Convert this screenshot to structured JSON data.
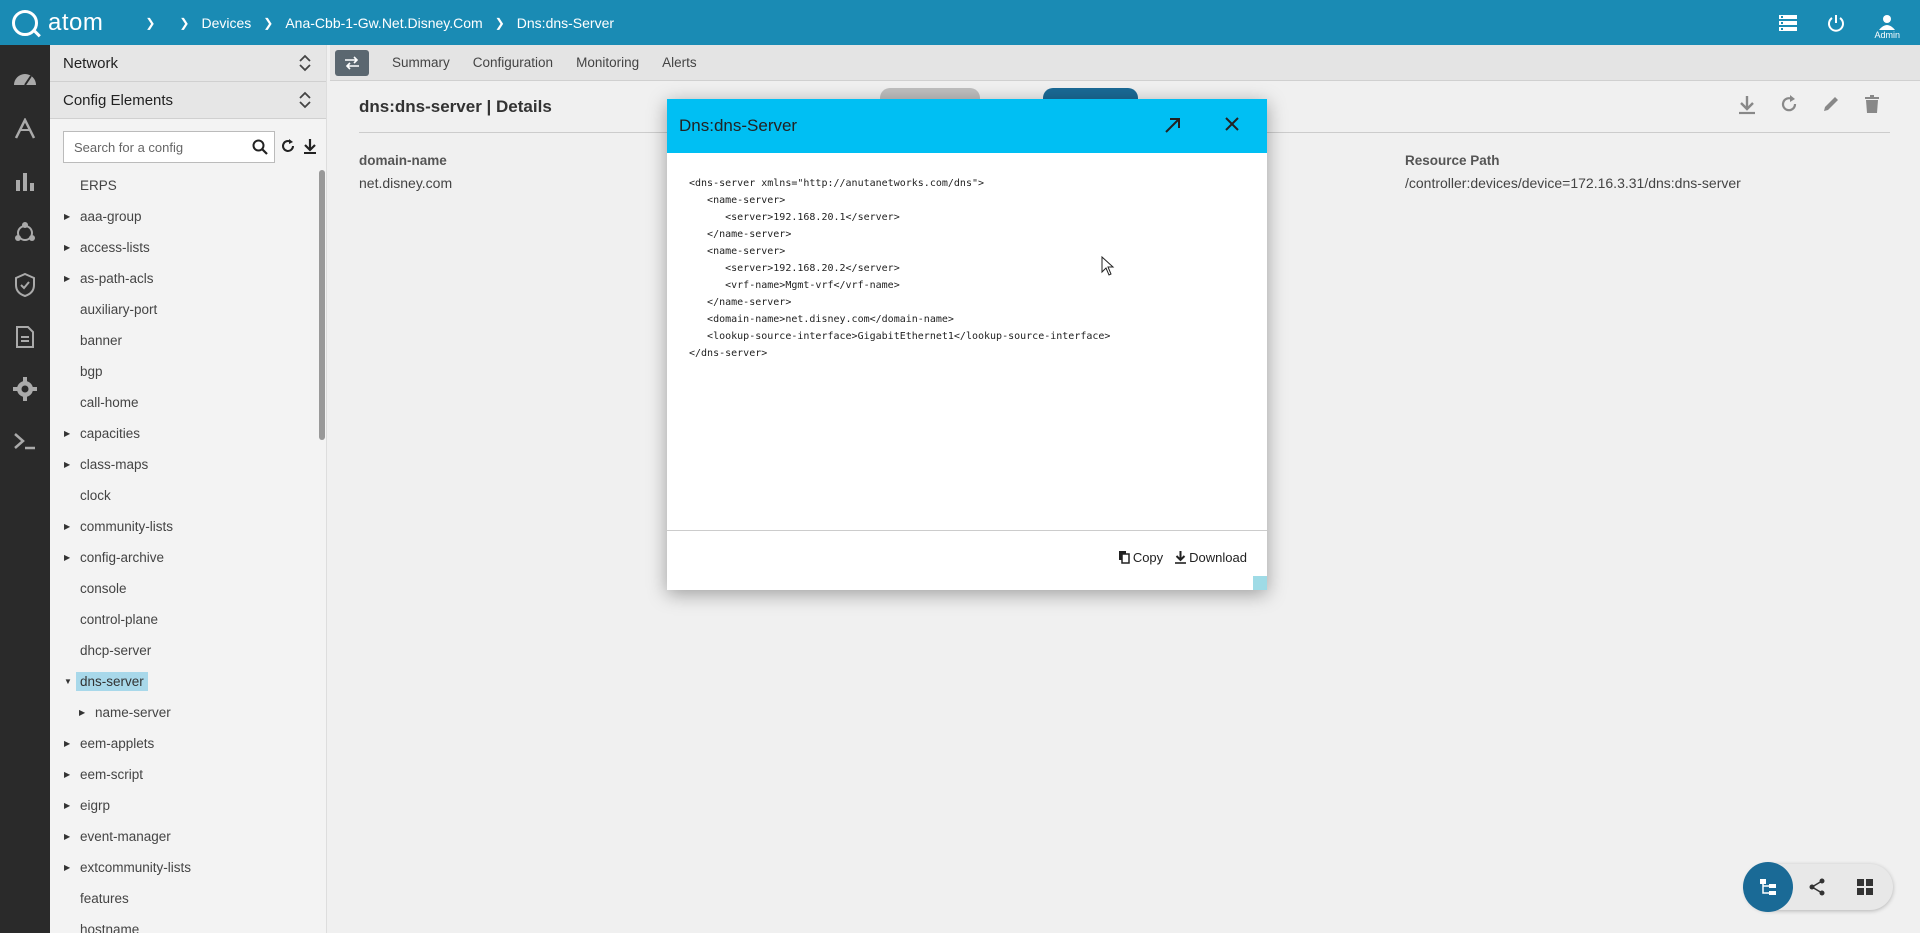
{
  "app": {
    "logo_text": "atom",
    "breadcrumbs": [
      "Devices",
      "Ana-Cbb-1-Gw.Net.Disney.Com",
      "Dns:dns-Server"
    ],
    "user_label": "Admin"
  },
  "sidebar": {
    "network_label": "Network",
    "config_elements_label": "Config Elements",
    "search_placeholder": "Search for a config",
    "tree": [
      {
        "label": "ERPS",
        "expandable": false
      },
      {
        "label": "aaa-group",
        "expandable": true
      },
      {
        "label": "access-lists",
        "expandable": true
      },
      {
        "label": "as-path-acls",
        "expandable": true
      },
      {
        "label": "auxiliary-port",
        "expandable": false
      },
      {
        "label": "banner",
        "expandable": false
      },
      {
        "label": "bgp",
        "expandable": false
      },
      {
        "label": "call-home",
        "expandable": false
      },
      {
        "label": "capacities",
        "expandable": true
      },
      {
        "label": "class-maps",
        "expandable": true
      },
      {
        "label": "clock",
        "expandable": false
      },
      {
        "label": "community-lists",
        "expandable": true
      },
      {
        "label": "config-archive",
        "expandable": true
      },
      {
        "label": "console",
        "expandable": false
      },
      {
        "label": "control-plane",
        "expandable": false
      },
      {
        "label": "dhcp-server",
        "expandable": false
      },
      {
        "label": "dns-server",
        "expandable": true,
        "expanded": true,
        "selected": true
      },
      {
        "label": "name-server",
        "expandable": true,
        "child": true
      },
      {
        "label": "eem-applets",
        "expandable": true
      },
      {
        "label": "eem-script",
        "expandable": true
      },
      {
        "label": "eigrp",
        "expandable": true
      },
      {
        "label": "event-manager",
        "expandable": true
      },
      {
        "label": "extcommunity-lists",
        "expandable": true
      },
      {
        "label": "features",
        "expandable": false
      },
      {
        "label": "hostname",
        "expandable": false
      }
    ]
  },
  "tabs": [
    "Summary",
    "Configuration",
    "Monitoring",
    "Alerts"
  ],
  "details": {
    "title": "dns:dns-server | Details",
    "field1_label": "domain-name",
    "field1_value": "net.disney.com",
    "field2_label": "Resource Path",
    "field2_value": "/controller:devices/device=172.16.3.31/dns:dns-server"
  },
  "modal": {
    "title": "Dns:dns-Server",
    "code_lines": [
      "<dns-server xmlns=\"http://anutanetworks.com/dns\">",
      "   <name-server>",
      "      <server>192.168.20.1</server>",
      "   </name-server>",
      "   <name-server>",
      "      <server>192.168.20.2</server>",
      "      <vrf-name>Mgmt-vrf</vrf-name>",
      "   </name-server>",
      "   <domain-name>net.disney.com</domain-name>",
      "   <lookup-source-interface>GigabitEthernet1</lookup-source-interface>",
      "</dns-server>"
    ],
    "copy_label": "Copy",
    "download_label": "Download"
  },
  "colors": {
    "topbar": "#1a8bb4",
    "modal_header": "#00bff3",
    "rail": "#2a2a2a",
    "selected_item": "#a8d8ea",
    "active_view": "#1a6a96"
  }
}
